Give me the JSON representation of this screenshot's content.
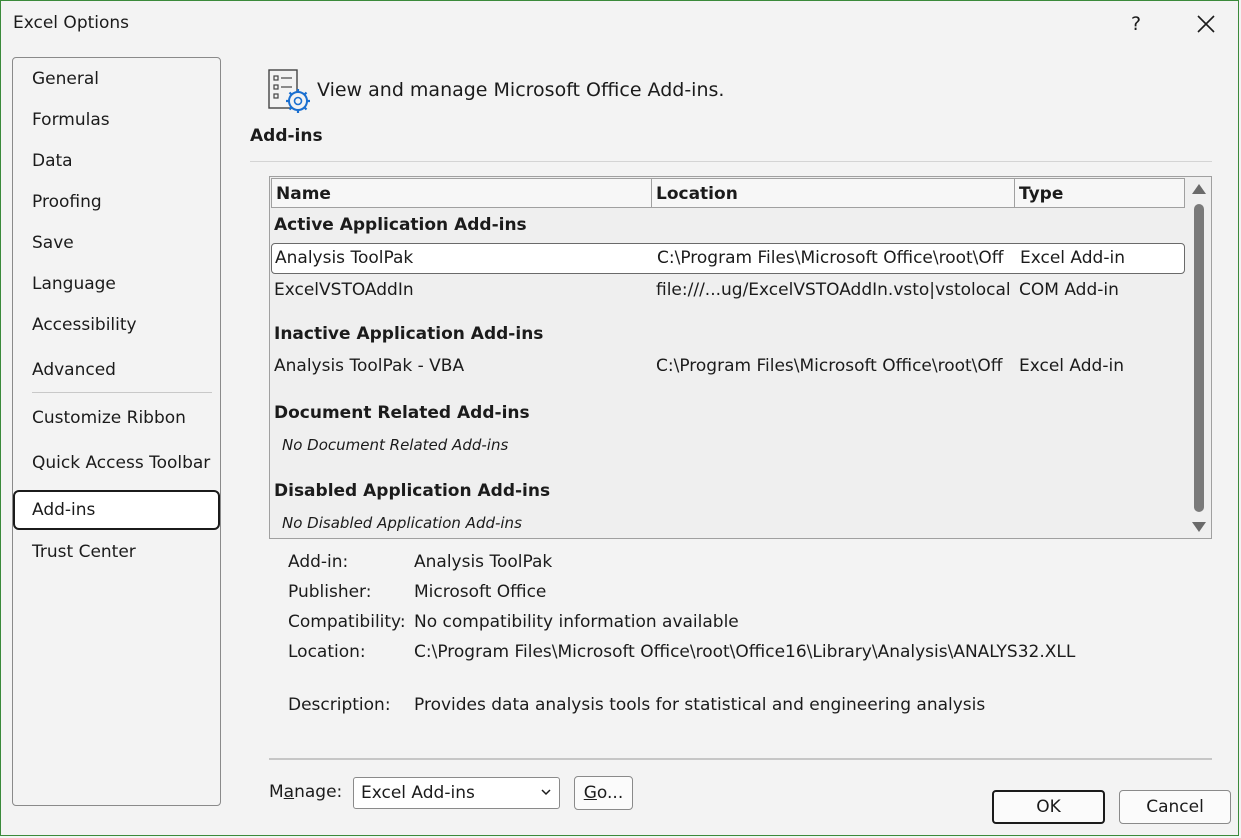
{
  "window": {
    "title": "Excel Options",
    "help_label": "?",
    "close_label": "✕"
  },
  "sidebar": {
    "items": [
      {
        "label": "General"
      },
      {
        "label": "Formulas"
      },
      {
        "label": "Data"
      },
      {
        "label": "Proofing"
      },
      {
        "label": "Save"
      },
      {
        "label": "Language"
      },
      {
        "label": "Accessibility"
      },
      {
        "label": "Advanced"
      },
      {
        "label": "Customize Ribbon"
      },
      {
        "label": "Quick Access Toolbar"
      },
      {
        "label": "Add-ins"
      },
      {
        "label": "Trust Center"
      }
    ],
    "selected": "Add-ins"
  },
  "header": {
    "text": "View and manage Microsoft Office Add-ins.",
    "icon": "addins-settings-icon"
  },
  "section": {
    "title": "Add-ins"
  },
  "table": {
    "columns": [
      "Name",
      "Location",
      "Type"
    ],
    "groups": [
      {
        "label": "Active Application Add-ins",
        "rows": [
          {
            "name": "Analysis ToolPak",
            "location": "C:\\Program Files\\Microsoft Office\\root\\Off",
            "type": "Excel Add-in",
            "selected": true
          },
          {
            "name": "ExcelVSTOAddIn",
            "location": "file:///...ug/ExcelVSTOAddIn.vsto|vstolocal",
            "type": "COM Add-in"
          }
        ]
      },
      {
        "label": "Inactive Application Add-ins",
        "rows": [
          {
            "name": "Analysis ToolPak - VBA",
            "location": "C:\\Program Files\\Microsoft Office\\root\\Off",
            "type": "Excel Add-in"
          }
        ]
      },
      {
        "label": "Document Related Add-ins",
        "empty": "No Document Related Add-ins"
      },
      {
        "label": "Disabled Application Add-ins",
        "empty": "No Disabled Application Add-ins"
      }
    ]
  },
  "details": {
    "addin_label": "Add-in:",
    "addin_value": "Analysis ToolPak",
    "publisher_label": "Publisher:",
    "publisher_value": "Microsoft Office",
    "compat_label": "Compatibility:",
    "compat_value": "No compatibility information available",
    "location_label": "Location:",
    "location_value": "C:\\Program Files\\Microsoft Office\\root\\Office16\\Library\\Analysis\\ANALYS32.XLL",
    "desc_label": "Description:",
    "desc_value": "Provides data analysis tools for statistical and engineering analysis"
  },
  "footer": {
    "manage_label_pre": "M",
    "manage_label_ul": "a",
    "manage_label_post": "nage:",
    "manage_value": "Excel Add-ins",
    "go_ul": "G",
    "go_post": "o...",
    "ok_label": "OK",
    "cancel_label": "Cancel"
  },
  "colors": {
    "accent_border": "#3a8a3a",
    "background": "#f3f3f3",
    "icon_blue": "#1a6fd0"
  }
}
